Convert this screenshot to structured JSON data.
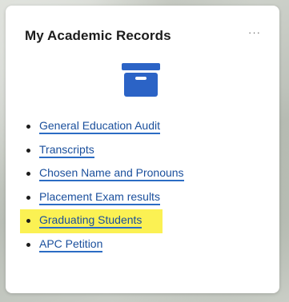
{
  "card": {
    "title": "My Academic Records",
    "menu_label": "···",
    "icon": "archive-box-icon",
    "icon_color": "#2b63c6",
    "links": [
      {
        "label": "General Education Audit",
        "highlighted": false
      },
      {
        "label": "Transcripts",
        "highlighted": false
      },
      {
        "label": "Chosen Name and Pronouns",
        "highlighted": false
      },
      {
        "label": "Placement Exam results",
        "highlighted": false
      },
      {
        "label": "Graduating Students",
        "highlighted": true
      },
      {
        "label": "APC Petition",
        "highlighted": false
      }
    ]
  },
  "colors": {
    "link": "#1a4f9c",
    "link_underline": "#2b6cc4",
    "highlight": "#fbf153"
  }
}
